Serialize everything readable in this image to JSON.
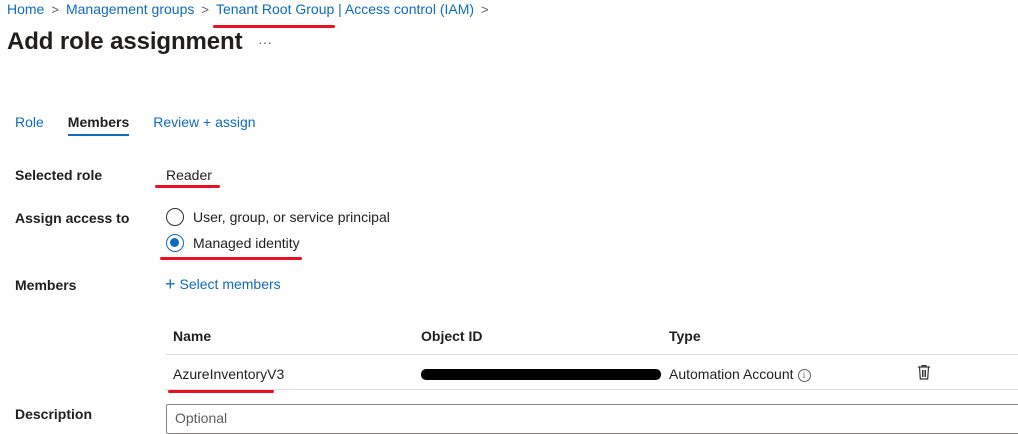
{
  "breadcrumb": {
    "items": [
      "Home",
      "Management groups",
      "Tenant Root Group | Access control (IAM)"
    ],
    "separator": ">"
  },
  "page": {
    "title": "Add role assignment",
    "more": "···"
  },
  "tabs": [
    {
      "label": "Role",
      "active": false
    },
    {
      "label": "Members",
      "active": true
    },
    {
      "label": "Review + assign",
      "active": false
    }
  ],
  "form": {
    "selected_role_label": "Selected role",
    "selected_role_value": "Reader",
    "assign_access_label": "Assign access to",
    "assign_options": [
      {
        "label": "User, group, or service principal",
        "checked": false
      },
      {
        "label": "Managed identity",
        "checked": true
      }
    ],
    "members_label": "Members",
    "select_members": "Select members",
    "description_label": "Description",
    "description_placeholder": "Optional"
  },
  "members_table": {
    "columns": [
      "Name",
      "Object ID",
      "Type"
    ],
    "rows": [
      {
        "name": "AzureInventoryV3",
        "object_id": "",
        "type": "Automation Account"
      }
    ]
  },
  "colors": {
    "link": "#0f6cbd",
    "annotation": "#e81123"
  },
  "icons": [
    "chevron-right-icon",
    "more-icon",
    "plus-icon",
    "info-icon",
    "trash-icon"
  ]
}
